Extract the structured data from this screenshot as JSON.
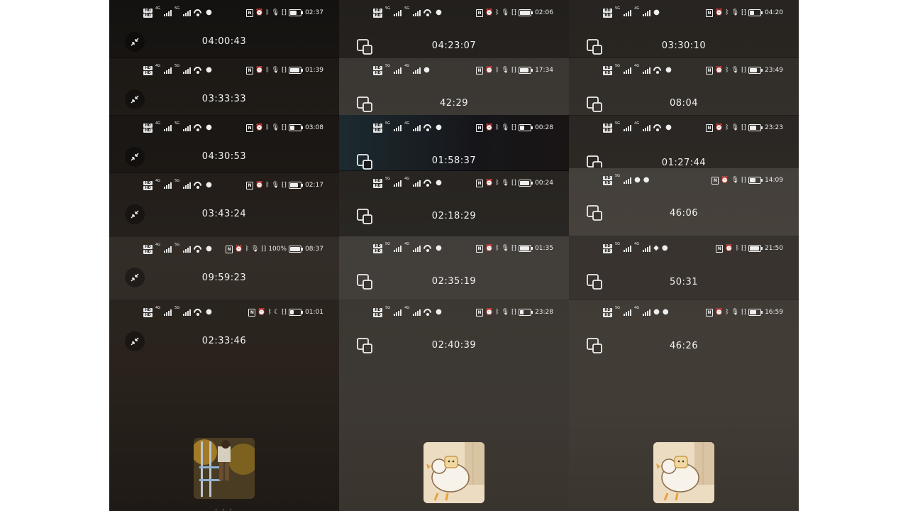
{
  "columns": [
    {
      "strips": [
        {
          "clock": "02:37",
          "duration": "04:00:43",
          "battery_percent": null,
          "icon": "minimize-icon"
        },
        {
          "clock": "01:39",
          "duration": "03:33:33",
          "battery_percent": null,
          "icon": "minimize-icon"
        },
        {
          "clock": "03:08",
          "duration": "04:30:53",
          "battery_percent": null,
          "icon": "minimize-icon"
        },
        {
          "clock": "02:17",
          "duration": "03:43:24",
          "battery_percent": null,
          "icon": "minimize-icon"
        },
        {
          "clock": "08:37",
          "duration": "09:59:23",
          "battery_percent": "100%",
          "icon": "minimize-icon"
        },
        {
          "clock": "01:01",
          "duration": "02:33:46",
          "battery_percent": null,
          "icon": "minimize-icon"
        }
      ],
      "thumbnail": "photo",
      "caption": "· · ·"
    },
    {
      "strips": [
        {
          "clock": "02:06",
          "duration": "04:23:07",
          "icon": "screen-share-icon"
        },
        {
          "clock": "17:34",
          "duration": "42:29",
          "icon": "screen-share-icon"
        },
        {
          "clock": "00:28",
          "duration": "01:58:37",
          "icon": "screen-share-icon"
        },
        {
          "clock": "00:24",
          "duration": "02:18:29",
          "icon": "screen-share-icon"
        },
        {
          "clock": "01:35",
          "duration": "02:35:19",
          "icon": "screen-share-icon"
        },
        {
          "clock": "23:28",
          "duration": "02:40:39",
          "icon": "screen-share-icon"
        }
      ],
      "thumbnail": "duck"
    },
    {
      "strips": [
        {
          "clock": "04:20",
          "duration": "03:30:10",
          "icon": "screen-share-icon"
        },
        {
          "clock": "23:49",
          "duration": "08:04",
          "icon": "screen-share-icon"
        },
        {
          "clock": "23:23",
          "duration": "01:27:44",
          "icon": "screen-share-icon"
        },
        {
          "clock": "14:09",
          "duration": "46:06",
          "icon": "screen-share-icon"
        },
        {
          "clock": "21:50",
          "duration": "50:31",
          "icon": "screen-share-icon"
        },
        {
          "clock": "16:59",
          "duration": "46:26",
          "icon": "screen-share-icon"
        }
      ],
      "thumbnail": "duck"
    }
  ]
}
